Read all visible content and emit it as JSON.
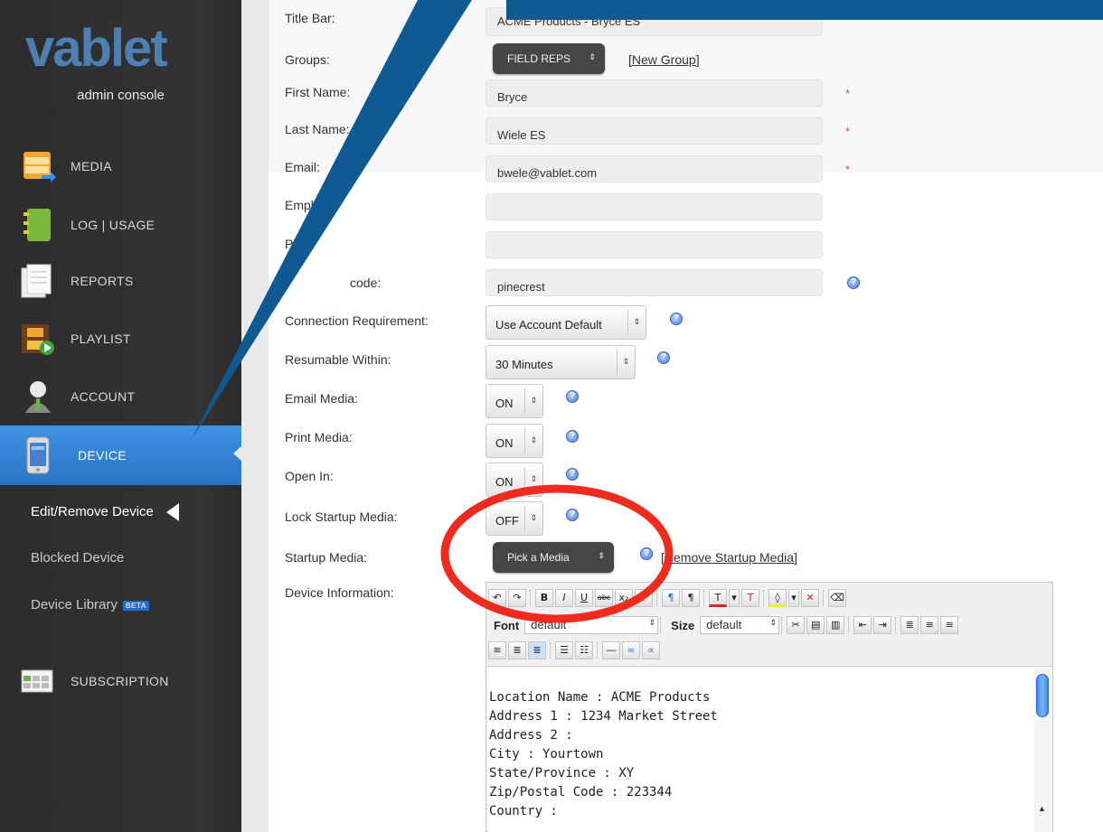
{
  "sidebar": {
    "logo": "vablet",
    "subtitle": "admin console",
    "items": [
      {
        "label": "MEDIA",
        "icon": "cabinet-icon"
      },
      {
        "label": "LOG | USAGE",
        "icon": "notebook-icon"
      },
      {
        "label": "REPORTS",
        "icon": "documents-icon"
      },
      {
        "label": "PLAYLIST",
        "icon": "film-play-icon"
      },
      {
        "label": "ACCOUNT",
        "icon": "person-icon"
      },
      {
        "label": "DEVICE",
        "icon": "phone-icon",
        "active": true
      },
      {
        "label": "SUBSCRIPTION",
        "icon": "calendar-icon"
      }
    ],
    "sub_items": [
      "Edit/Remove Device",
      "Blocked Device",
      "Device Library"
    ],
    "beta_badge": "BETA"
  },
  "form": {
    "title_bar": {
      "label": "Title Bar:",
      "value": "ACME Products - Bryce ES"
    },
    "groups": {
      "label": "Groups:",
      "value": "FIELD REPS",
      "new_group_link": "[New Group]"
    },
    "first_name": {
      "label": "First Name:",
      "value": "Bryce"
    },
    "last_name": {
      "label": "Last Name:",
      "value": "Wiele ES"
    },
    "email": {
      "label": "Email:",
      "value": "bwele@vablet.com"
    },
    "employee_id": {
      "label": "Empl",
      "value": ""
    },
    "phone": {
      "label": "Ph",
      "value": ""
    },
    "passcode": {
      "label": "code:",
      "value": "pinecrest"
    },
    "connection_requirement": {
      "label": "Connection Requirement:",
      "value": "Use Account Default"
    },
    "resumable_within": {
      "label": "Resumable Within:",
      "value": "30 Minutes"
    },
    "email_media": {
      "label": "Email Media:",
      "value": "ON"
    },
    "print_media": {
      "label": "Print Media:",
      "value": "ON"
    },
    "open_in": {
      "label": "Open In:",
      "value": "ON"
    },
    "lock_startup_media": {
      "label": "Lock Startup Media:",
      "value": "OFF"
    },
    "startup_media": {
      "label": "Startup Media:",
      "value": "Pick a Media",
      "remove_link": "[Remove Startup Media]"
    },
    "device_information": {
      "label": "Device Information:"
    },
    "required_marker": "*"
  },
  "editor": {
    "font_label": "Font",
    "font_value": "default",
    "size_label": "Size",
    "size_value": "default",
    "content_lines": [
      "Location Name : ACME Products",
      "",
      "Address 1 : 1234 Market Street",
      "Address 2 :",
      "City : Yourtown",
      "State/Province : XY",
      "Zip/Postal Code : 223344",
      "Country :"
    ]
  },
  "colors": {
    "sidebar_bg": "#333333",
    "active_nav": "#2f80d6",
    "callout": "#0f5a93",
    "highlight_circle": "#ef2a1e"
  }
}
